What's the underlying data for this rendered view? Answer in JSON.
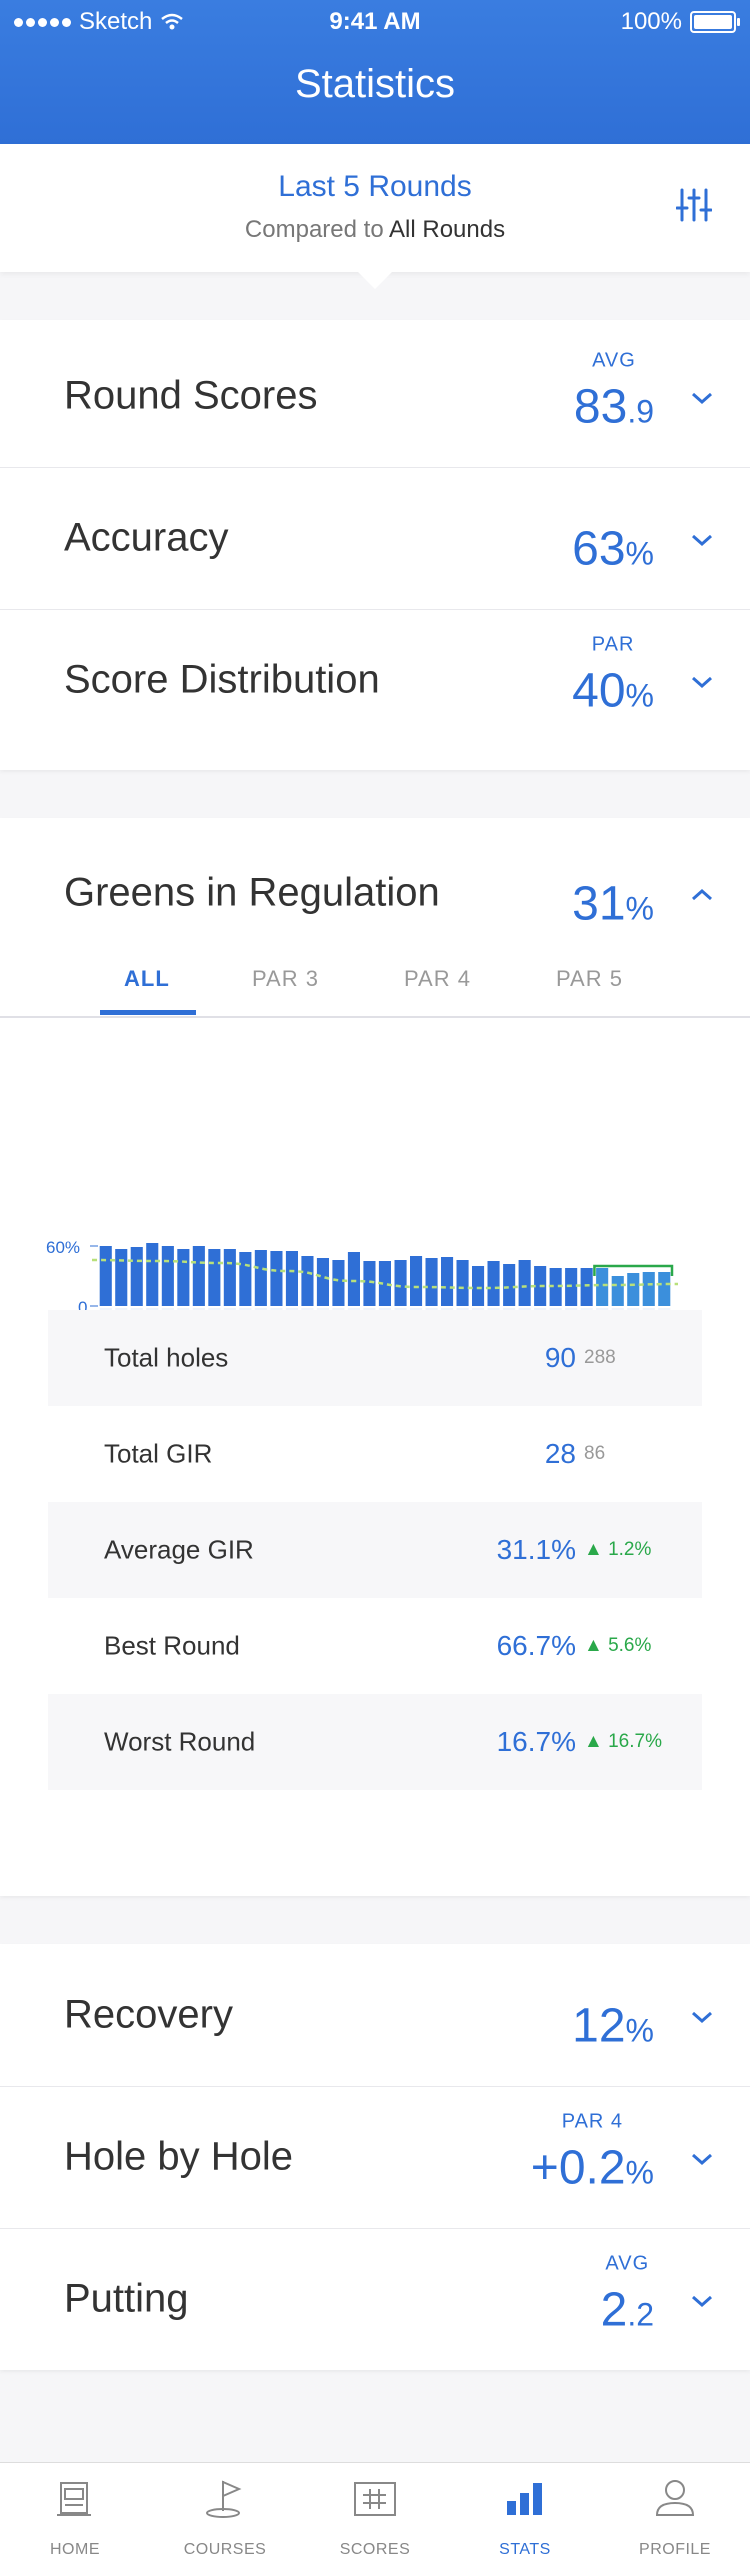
{
  "status_bar": {
    "carrier": "Sketch",
    "time": "9:41 AM",
    "battery": "100%"
  },
  "header": {
    "title": "Statistics"
  },
  "compare": {
    "period": "Last 5 Rounds",
    "compared_prefix": "Compared to",
    "compared_target": "All Rounds"
  },
  "sections_top": [
    {
      "label": "Round Scores",
      "caption": "AVG",
      "value_big": "83",
      "value_small": ".9"
    },
    {
      "label": "Accuracy",
      "caption": "",
      "value_big": "63",
      "value_small": "%"
    },
    {
      "label": "Score Distribution",
      "caption": "PAR",
      "value_big": "40",
      "value_small": "%"
    }
  ],
  "gir": {
    "label": "Greens in Regulation",
    "value_big": "31",
    "value_small": "%",
    "tabs": [
      "ALL",
      "PAR 3",
      "PAR 4",
      "PAR 5"
    ],
    "active_tab": "ALL",
    "stats": [
      {
        "label": "Total holes",
        "value": "90",
        "compare": "288",
        "trend": ""
      },
      {
        "label": "Total GIR",
        "value": "28",
        "compare": "86",
        "trend": ""
      },
      {
        "label": "Average GIR",
        "value": "31.1%",
        "compare": "▲ 1.2%",
        "trend": "up"
      },
      {
        "label": "Best Round",
        "value": "66.7%",
        "compare": "▲ 5.6%",
        "trend": "up"
      },
      {
        "label": "Worst Round",
        "value": "16.7%",
        "compare": "▲ 16.7%",
        "trend": "up"
      }
    ]
  },
  "chart_data": {
    "type": "bar",
    "y_tick_labels": [
      "60%",
      "0"
    ],
    "ylim": [
      0,
      60
    ],
    "values": [
      60,
      57,
      59,
      63,
      60,
      57,
      60,
      57,
      57,
      54,
      56,
      55,
      55,
      50,
      48,
      46,
      54,
      45,
      45,
      46,
      50,
      48,
      49,
      46,
      40,
      45,
      42,
      46,
      40,
      38,
      38,
      38,
      38,
      30,
      33,
      34,
      34
    ],
    "highlighted_last_n": 5,
    "trend_line": [
      46,
      45,
      43,
      35,
      25,
      19,
      18,
      20,
      21,
      22
    ]
  },
  "sections_bottom": [
    {
      "label": "Recovery",
      "caption": "",
      "value_big": "12",
      "value_small": "%"
    },
    {
      "label": "Hole by Hole",
      "caption": "PAR 4",
      "value_big": "+0.2",
      "value_small": "%"
    },
    {
      "label": "Putting",
      "caption": "AVG",
      "value_big": "2",
      "value_small": ".2"
    }
  ],
  "nav": [
    {
      "label": "HOME",
      "icon": "home-icon"
    },
    {
      "label": "COURSES",
      "icon": "flag-icon"
    },
    {
      "label": "SCORES",
      "icon": "scorecard-icon"
    },
    {
      "label": "STATS",
      "icon": "bar-chart-icon",
      "active": true
    },
    {
      "label": "PROFILE",
      "icon": "profile-icon"
    }
  ],
  "colors": {
    "brand": "#2f6fd6",
    "trend_up": "#2aa84a"
  }
}
